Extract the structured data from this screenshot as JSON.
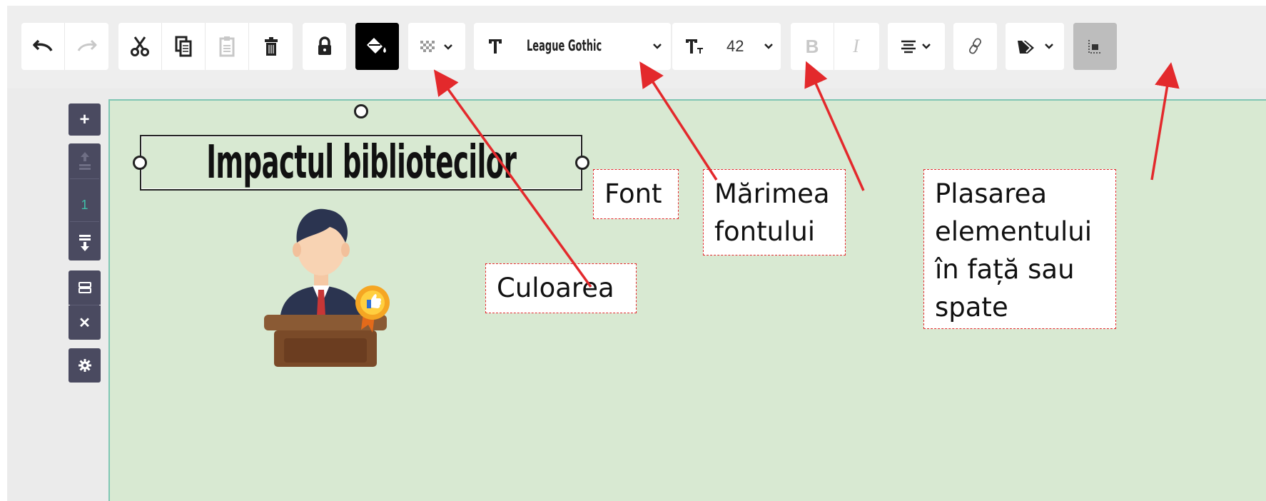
{
  "toolbar": {
    "font_name": "League Gothic",
    "font_size": "42",
    "bold_label": "B",
    "italic_label": "I",
    "icons": [
      "undo-icon",
      "redo-icon",
      "cut-icon",
      "copy-icon",
      "paste-icon",
      "delete-icon",
      "lock-icon",
      "fill-color-icon",
      "transparency-icon",
      "text-icon",
      "font-size-icon",
      "align-icon",
      "link-icon",
      "layer-order-icon",
      "position-icon"
    ]
  },
  "sidebar": {
    "page_number": "1",
    "add_label": "+",
    "close_label": "✕"
  },
  "canvas": {
    "title_text": "Impactul bibliotecilor",
    "image_icon": "speaker-at-podium-icon"
  },
  "annotations": {
    "font": "Font",
    "font_size_lines": [
      "Mărimea",
      "fontului"
    ],
    "color": "Culoarea",
    "placement_lines": [
      "Plasarea",
      "elementului",
      "în față sau",
      "spate"
    ]
  },
  "colors": {
    "canvas_bg": "#d8e9d2",
    "canvas_border": "#7fc6b3",
    "sidebar_bg": "#4a4a60",
    "annotation_red": "#e3292c",
    "page_number_color": "#3fbfa8"
  }
}
